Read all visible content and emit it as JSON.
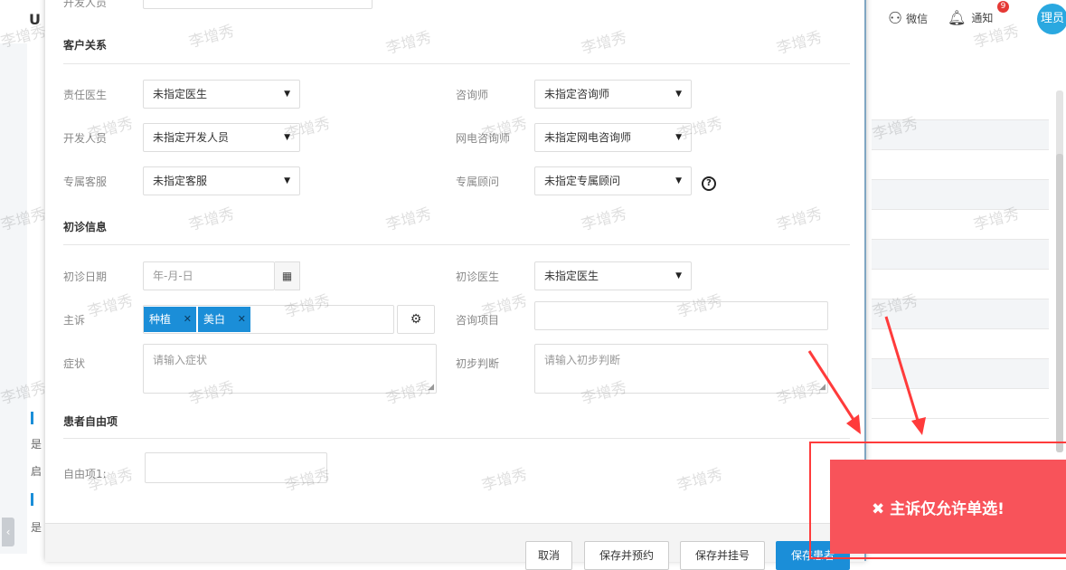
{
  "background": {
    "logo": "U",
    "wechat_label": "微信",
    "notify_label": "通知",
    "notify_badge": "9",
    "avatar_text": "理员",
    "side_texts": [
      "是",
      "启",
      "是"
    ]
  },
  "form": {
    "top_cut_label": "开发人员",
    "sections": {
      "customer_relation": "客户关系",
      "first_visit": "初诊信息",
      "free_items": "患者自由项"
    },
    "fields": {
      "responsible_doctor": {
        "label": "责任医生",
        "value": "未指定医生"
      },
      "consultant": {
        "label": "咨询师",
        "value": "未指定咨询师"
      },
      "developer": {
        "label": "开发人员",
        "value": "未指定开发人员"
      },
      "online_consultant": {
        "label": "网电咨询师",
        "value": "未指定网电咨询师"
      },
      "exclusive_service": {
        "label": "专属客服",
        "value": "未指定客服"
      },
      "exclusive_advisor": {
        "label": "专属顾问",
        "value": "未指定专属顾问"
      },
      "first_visit_date": {
        "label": "初诊日期",
        "placeholder": "年-月-日"
      },
      "first_visit_doctor": {
        "label": "初诊医生",
        "value": "未指定医生"
      },
      "chief_complaint": {
        "label": "主诉",
        "tags": [
          "种植",
          "美白"
        ]
      },
      "consult_item": {
        "label": "咨询项目",
        "value": ""
      },
      "symptom": {
        "label": "症状",
        "placeholder": "请输入症状"
      },
      "initial_judgment": {
        "label": "初步判断",
        "placeholder": "请输入初步判断"
      },
      "free_item_1": {
        "label": "自由项1:",
        "value": ""
      }
    }
  },
  "footer": {
    "cancel": "取消",
    "save_and_book": "保存并预约",
    "save_and_register": "保存并挂号",
    "save_patient": "保存患者"
  },
  "toast": {
    "message": "主诉仅允许单选!",
    "icon": "close-icon"
  },
  "watermark": "李增秀",
  "colors": {
    "primary": "#1b8ed8",
    "toast_bg": "#f8535a",
    "highlight_red": "#ff3b3b"
  }
}
